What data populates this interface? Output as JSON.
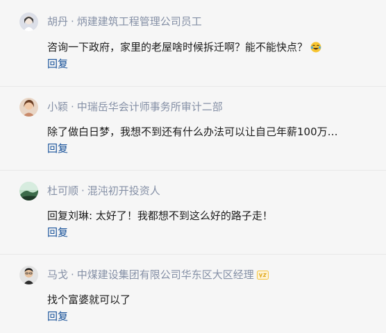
{
  "comments": [
    {
      "author": "胡丹",
      "separator": "·",
      "title": "炳建建筑工程管理公司员工",
      "text": "咨询一下政府，家里的老屋啥时候拆迁啊？能不能快点？",
      "reply_label": "回复",
      "emoji_icon": "laughing-tears-emoji"
    },
    {
      "author": "小颖",
      "separator": "·",
      "title": "中瑞岳华会计师事务所审计二部",
      "text": "除了做白日梦，我想不到还有什么办法可以让自己年薪100万…",
      "reply_label": "回复"
    },
    {
      "author": "杜可顺",
      "separator": "·",
      "title": "混沌初开投资人",
      "text": "回复刘琳: 太好了！我都想不到这么好的路子走！",
      "reply_label": "回复"
    },
    {
      "author": "马戈",
      "separator": "·",
      "title": "中煤建设集团有限公司华东区大区经理",
      "text": "找个富婆就可以了",
      "reply_label": "回复",
      "badge_icon": "verified-badge-icon"
    }
  ],
  "colors": {
    "meta": "#8590a6",
    "reply": "#175199",
    "badge": "#f5c542"
  }
}
